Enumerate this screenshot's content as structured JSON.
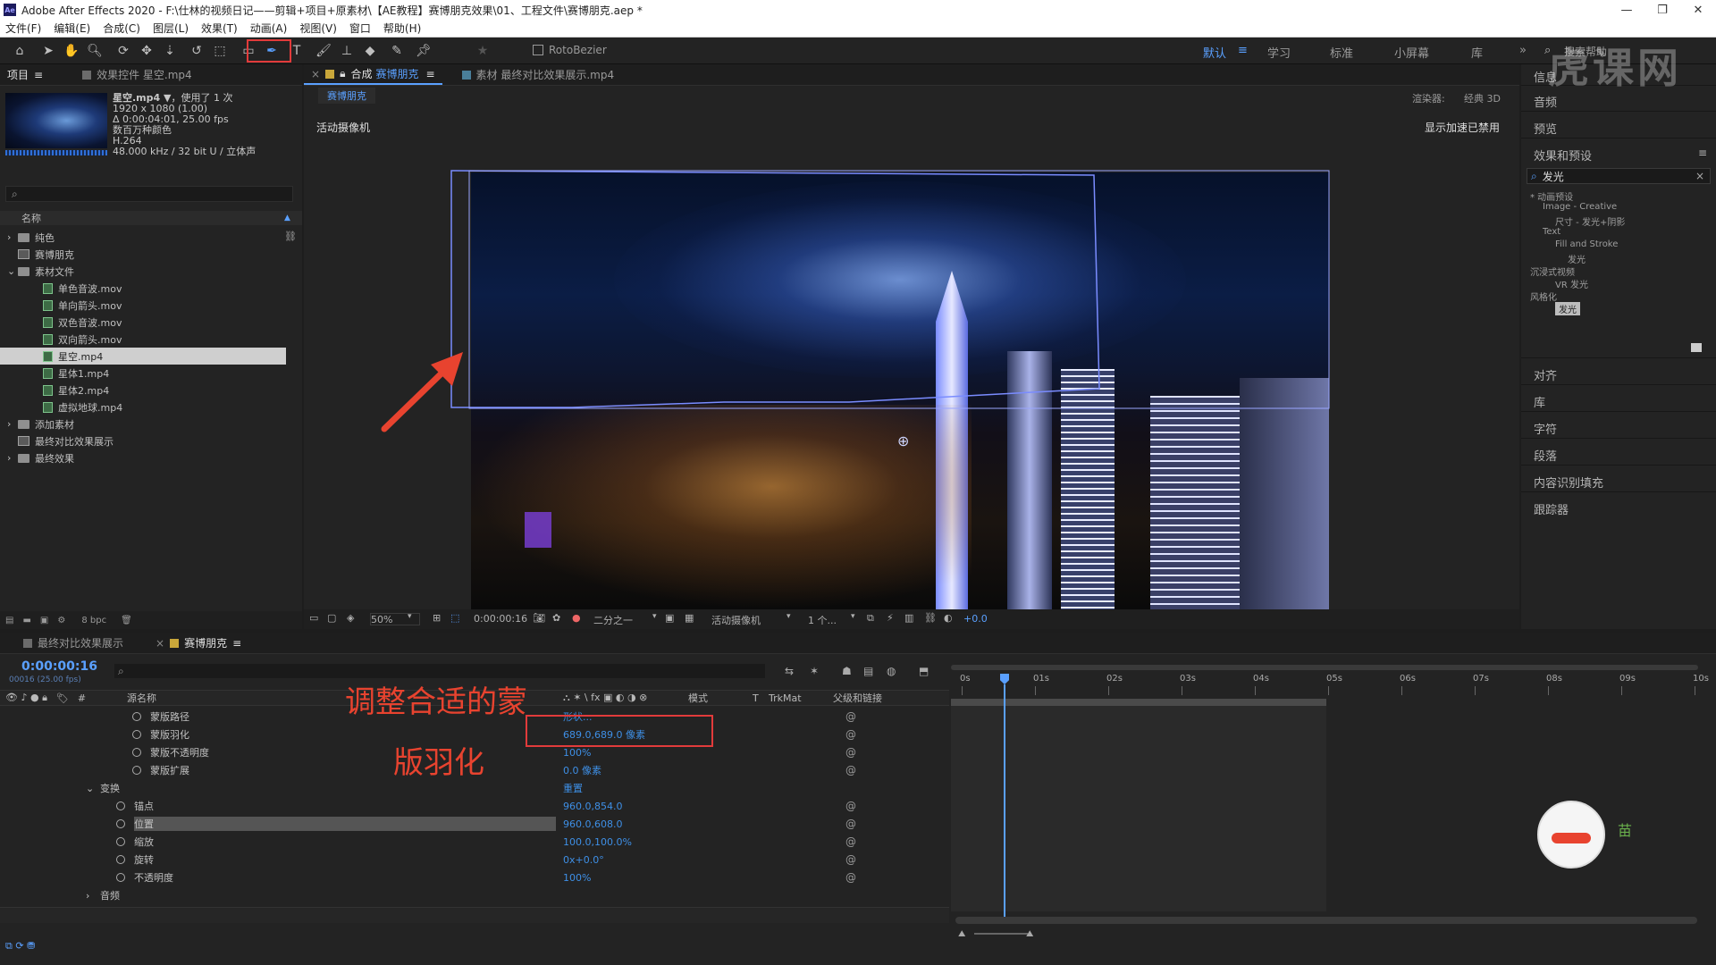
{
  "window": {
    "title": "Adobe After Effects 2020 - F:\\仕林的视频日记——剪辑+项目+原素材\\【AE教程】赛博朋克效果\\01、工程文件\\赛博朋克.aep *",
    "logo_text": "Ae",
    "minimize": "—",
    "restore": "❐",
    "close": "✕"
  },
  "menu": [
    "文件(F)",
    "编辑(E)",
    "合成(C)",
    "图层(L)",
    "效果(T)",
    "动画(A)",
    "视图(V)",
    "窗口",
    "帮助(H)"
  ],
  "toolbar": {
    "rotobezier_label": "RotoBezier",
    "workspaces": [
      "默认",
      "学习",
      "标准",
      "小屏幕",
      "库"
    ],
    "search_help": "搜索帮助"
  },
  "project": {
    "tab_project": "项目",
    "tab_effects": "效果控件 星空.mp4",
    "preview_name": "星空.mp4 ▼",
    "preview_used": "，使用了 1 次",
    "preview_res": "1920 x 1080 (1.00)",
    "preview_dur": "Δ 0:00:04:01, 25.00 fps",
    "preview_color": "数百万种颜色",
    "preview_codec": "H.264",
    "preview_audio": "48.000 kHz / 32 bit U / 立体声",
    "search_placeholder": "",
    "col_name": "名称",
    "items": [
      {
        "label": "纯色",
        "type": "folder",
        "indent": 0,
        "arrow": "›"
      },
      {
        "label": "赛博朋克",
        "type": "comp",
        "indent": 0,
        "arrow": ""
      },
      {
        "label": "素材文件",
        "type": "folder",
        "indent": 0,
        "arrow": "⌄"
      },
      {
        "label": "单色音波.mov",
        "type": "file",
        "indent": 1,
        "arrow": ""
      },
      {
        "label": "单向箭头.mov",
        "type": "file",
        "indent": 1,
        "arrow": ""
      },
      {
        "label": "双色音波.mov",
        "type": "file",
        "indent": 1,
        "arrow": ""
      },
      {
        "label": "双向箭头.mov",
        "type": "file",
        "indent": 1,
        "arrow": ""
      },
      {
        "label": "星空.mp4",
        "type": "file",
        "indent": 1,
        "arrow": "",
        "selected": true
      },
      {
        "label": "星体1.mp4",
        "type": "file",
        "indent": 1,
        "arrow": ""
      },
      {
        "label": "星体2.mp4",
        "type": "file",
        "indent": 1,
        "arrow": ""
      },
      {
        "label": "虚拟地球.mp4",
        "type": "file",
        "indent": 1,
        "arrow": ""
      },
      {
        "label": "添加素材",
        "type": "folder",
        "indent": 0,
        "arrow": "›"
      },
      {
        "label": "最终对比效果展示",
        "type": "comp",
        "indent": 0,
        "arrow": ""
      },
      {
        "label": "最终效果",
        "type": "folder",
        "indent": 0,
        "arrow": "›"
      }
    ],
    "bpc": "8 bpc"
  },
  "viewer": {
    "comp_tab_prefix": "合成",
    "comp_tab_name": "赛博朋克",
    "footage_tab": "素材 最终对比效果展示.mp4",
    "sub_tab": "赛博朋克",
    "renderer_label": "渲染器:",
    "renderer_value": "经典 3D",
    "camera_label": "活动摄像机",
    "accel_label": "显示加速已禁用",
    "zoom": "50%",
    "timecode": "0:00:00:16",
    "resolution": "二分之一",
    "camera_select": "活动摄像机",
    "views": "1 个...",
    "exposure": "+0.0"
  },
  "right": {
    "info": "信息",
    "audio": "音频",
    "preview": "预览",
    "effects_presets": "效果和预设",
    "effects_search": "发光",
    "tree": [
      {
        "label": "* 动画预设",
        "indent": 0
      },
      {
        "label": "Image - Creative",
        "indent": 1
      },
      {
        "label": "尺寸 - 发光+阴影",
        "indent": 2
      },
      {
        "label": "Text",
        "indent": 1
      },
      {
        "label": "Fill and Stroke",
        "indent": 2
      },
      {
        "label": "发光",
        "indent": 3
      },
      {
        "label": "沉浸式视频",
        "indent": 0
      },
      {
        "label": "VR 发光",
        "indent": 2
      },
      {
        "label": "风格化",
        "indent": 0
      },
      {
        "label": "发光",
        "indent": 2
      }
    ],
    "align": "对齐",
    "library": "库",
    "character": "字符",
    "paragraph": "段落",
    "content_fill": "内容识别填充",
    "tracker": "跟踪器"
  },
  "timeline": {
    "tab1": "最终对比效果展示",
    "tab2": "赛博朋克",
    "timecode": "0:00:00:16",
    "frame_info": "00016 (25.00 fps)",
    "col_source": "源名称",
    "col_mode": "模式",
    "col_t": "T",
    "col_trkmat": "TrkMat",
    "col_parent": "父级和链接",
    "ruler": [
      "0s",
      "01s",
      "02s",
      "03s",
      "04s",
      "05s",
      "06s",
      "07s",
      "08s",
      "09s",
      "10s"
    ],
    "rows": [
      {
        "name": "蒙版路径",
        "value": "形状...",
        "indent": 3
      },
      {
        "name": "蒙版羽化",
        "value": "689.0,689.0 像素",
        "indent": 3
      },
      {
        "name": "蒙版不透明度",
        "value": "100%",
        "indent": 3
      },
      {
        "name": "蒙版扩展",
        "value": "0.0 像素",
        "indent": 3
      },
      {
        "name": "变换",
        "value": "重置",
        "indent": 1,
        "group": true
      },
      {
        "name": "锚点",
        "value": "960.0,854.0",
        "indent": 2
      },
      {
        "name": "位置",
        "value": "960.0,608.0",
        "indent": 2,
        "selected": true
      },
      {
        "name": "缩放",
        "value": "100.0,100.0%",
        "indent": 2
      },
      {
        "name": "旋转",
        "value": "0x+0.0°",
        "indent": 2
      },
      {
        "name": "不透明度",
        "value": "100%",
        "indent": 2
      },
      {
        "name": "音频",
        "value": "",
        "indent": 1,
        "group": true
      }
    ]
  },
  "annotation": {
    "line1": "调整合适的蒙",
    "line2": "版羽化"
  },
  "watermark": "虎课网",
  "mascot_text": "苗",
  "colors": {
    "accent_blue": "#3e8fe6",
    "highlight_red": "#e23b3b",
    "annotation_red": "#e8432f"
  }
}
